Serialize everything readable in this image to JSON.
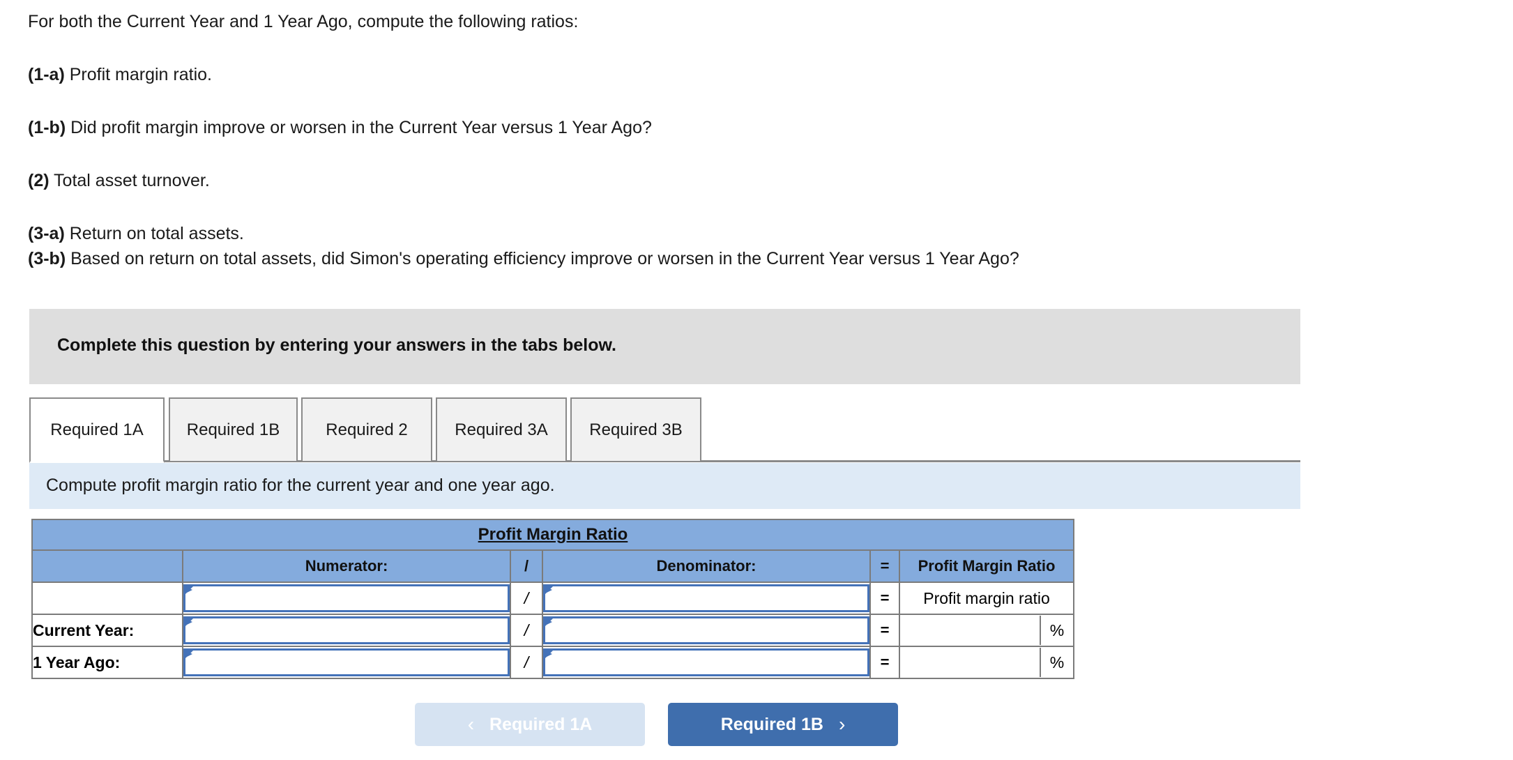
{
  "question": {
    "intro": "For both the Current Year and 1 Year Ago, compute the following ratios:",
    "item_1a_label": "(1-a)",
    "item_1a_text": " Profit margin ratio.",
    "item_1b_label": "(1-b)",
    "item_1b_text": " Did profit margin improve or worsen in the Current Year versus 1 Year Ago?",
    "item_2_label": "(2)",
    "item_2_text": " Total asset turnover.",
    "item_3a_label": "(3-a)",
    "item_3a_text": " Return on total assets.",
    "item_3b_label": "(3-b)",
    "item_3b_text": " Based on return on total assets, did Simon's operating efficiency improve or worsen in the Current Year versus 1 Year Ago?"
  },
  "instruction_banner": {
    "text": "Complete this question by entering your answers in the tabs below."
  },
  "tabs": [
    {
      "label": "Required 1A",
      "active": true
    },
    {
      "label": "Required 1B",
      "active": false
    },
    {
      "label": "Required 2",
      "active": false
    },
    {
      "label": "Required 3A",
      "active": false
    },
    {
      "label": "Required 3B",
      "active": false
    }
  ],
  "info_bar": {
    "text": "Compute profit margin ratio for the current year and one year ago."
  },
  "table": {
    "title": "Profit Margin Ratio",
    "headers": {
      "blank": "",
      "numerator": "Numerator:",
      "slash": "/",
      "denominator": "Denominator:",
      "equals": "=",
      "result": "Profit Margin Ratio"
    },
    "rows": [
      {
        "label": "",
        "numerator_value": "",
        "slash": "/",
        "denominator_value": "",
        "equals": "=",
        "result_text": "Profit margin ratio",
        "result_value": null,
        "percent": null
      },
      {
        "label": "Current Year:",
        "numerator_value": "",
        "slash": "/",
        "denominator_value": "",
        "equals": "=",
        "result_text": null,
        "result_value": "",
        "percent": "%"
      },
      {
        "label": "1 Year Ago:",
        "numerator_value": "",
        "slash": "/",
        "denominator_value": "",
        "equals": "=",
        "result_text": null,
        "result_value": "",
        "percent": "%"
      }
    ]
  },
  "footer": {
    "prev_label": "Required 1A",
    "prev_chevron": "‹",
    "next_label": "Required 1B",
    "next_chevron": "›"
  },
  "colors": {
    "header_blue": "#84abdd",
    "info_blue": "#deeaf6",
    "banner_gray": "#dedede",
    "input_border": "#4472b8",
    "next_button": "#3f6ead",
    "prev_button": "#d6e3f2",
    "table_border": "#7b7b7b"
  }
}
